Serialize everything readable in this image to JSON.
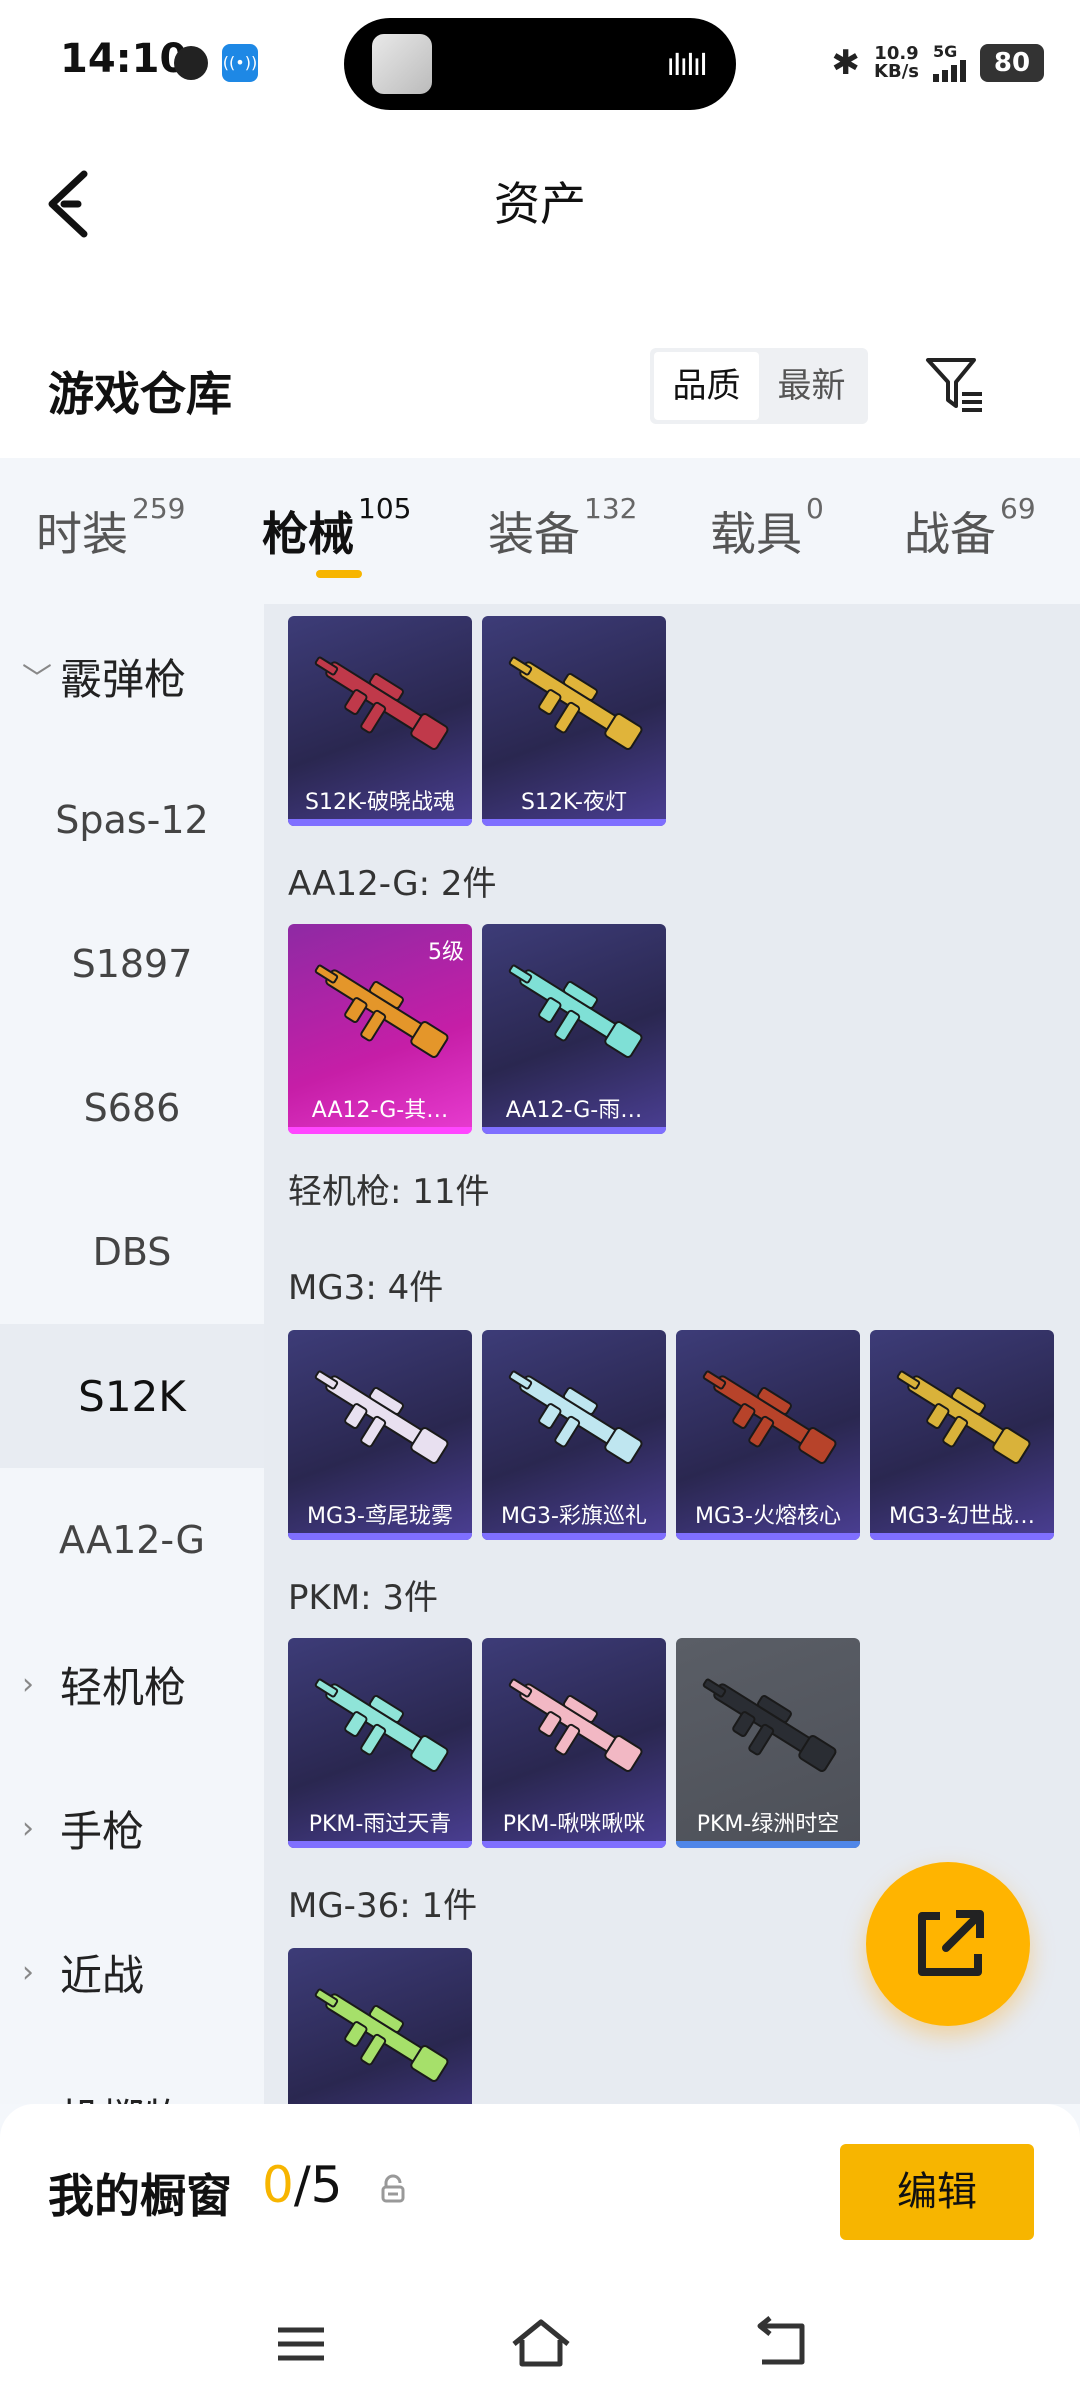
{
  "status_bar": {
    "time": "14:10",
    "net_speed_value": "10.9",
    "net_speed_unit": "KB/s",
    "network": "5G",
    "battery": "80"
  },
  "header": {
    "title": "资产"
  },
  "warehouse": {
    "title": "游戏仓库",
    "sort_options": [
      "品质",
      "最新"
    ],
    "active_sort": "品质"
  },
  "tabs": [
    {
      "label": "时装",
      "count": "259"
    },
    {
      "label": "枪械",
      "count": "105",
      "active": true
    },
    {
      "label": "装备",
      "count": "132"
    },
    {
      "label": "载具",
      "count": "0"
    },
    {
      "label": "战备",
      "count": "69"
    }
  ],
  "sidebar": [
    {
      "label": "霰弹枪",
      "type": "parent",
      "expanded": true
    },
    {
      "label": "Spas-12"
    },
    {
      "label": "S1897"
    },
    {
      "label": "S686"
    },
    {
      "label": "DBS"
    },
    {
      "label": "S12K",
      "active": true
    },
    {
      "label": "AA12-G"
    },
    {
      "label": "轻机枪",
      "type": "parent"
    },
    {
      "label": "手枪",
      "type": "parent"
    },
    {
      "label": "近战",
      "type": "parent"
    },
    {
      "label": "投掷物",
      "type": "parent"
    }
  ],
  "groups": {
    "s12k": {
      "items": [
        {
          "name": "S12K-破晓战魂",
          "gun_color": "#c0394a"
        },
        {
          "name": "S12K-夜灯",
          "gun_color": "#e0b43a"
        }
      ]
    },
    "aa12g": {
      "label": "AA12-G: 2件",
      "items": [
        {
          "name": "AA12-G-其…",
          "level": "5级",
          "style": "gold",
          "gun_color": "#e4962a"
        },
        {
          "name": "AA12-G-雨…",
          "gun_color": "#7fe0d6"
        }
      ]
    },
    "lmg": {
      "label": "轻机枪: 11件"
    },
    "mg3": {
      "label": "MG3: 4件",
      "items": [
        {
          "name": "MG3-鸢尾珑雾",
          "gun_color": "#e8e0f0"
        },
        {
          "name": "MG3-彩旗巡礼",
          "gun_color": "#bfe6f0"
        },
        {
          "name": "MG3-火熔核心",
          "gun_color": "#b7432a"
        },
        {
          "name": "MG3-幻世战…",
          "gun_color": "#d9b23a"
        }
      ]
    },
    "pkm": {
      "label": "PKM: 3件",
      "items": [
        {
          "name": "PKM-雨过天青",
          "gun_color": "#8fe4d8"
        },
        {
          "name": "PKM-啾咪啾咪",
          "gun_color": "#f2b8c4"
        },
        {
          "name": "PKM-绿洲时空",
          "style": "grey",
          "gun_color": "#2a2d33"
        }
      ]
    },
    "mg36": {
      "label": "MG-36: 1件",
      "items": [
        {
          "name": "",
          "gun_color": "#a6e06a"
        }
      ]
    }
  },
  "showcase": {
    "title": "我的橱窗",
    "current": "0",
    "total": "/5",
    "edit_label": "编辑"
  },
  "colors": {
    "accent": "#f7b500",
    "card_purple": "#3d3c78",
    "card_gold": "#c61ea7"
  }
}
